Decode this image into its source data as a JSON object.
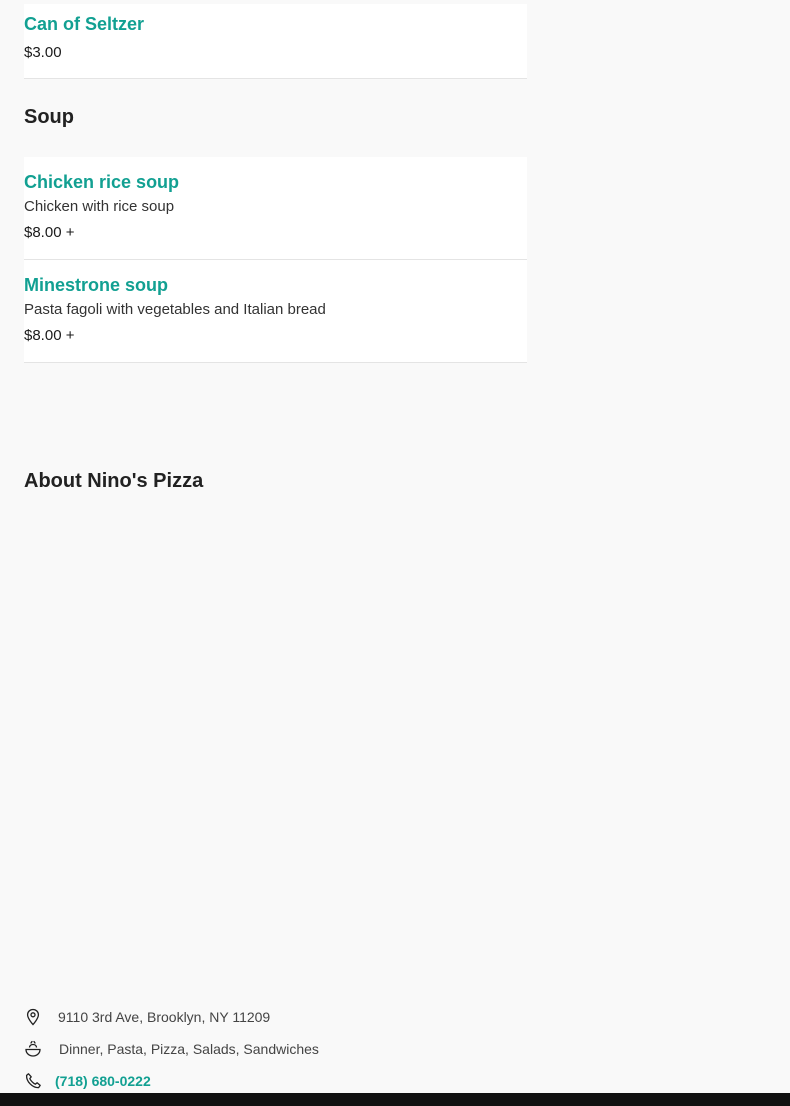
{
  "beverages": {
    "items": [
      {
        "name": "Can of Seltzer",
        "price": "$3.00"
      }
    ]
  },
  "soup": {
    "heading": "Soup",
    "items": [
      {
        "name": "Chicken rice soup",
        "description": "Chicken with rice soup",
        "price": "$8.00 +"
      },
      {
        "name": "Minestrone soup",
        "description": "Pasta fagoli with vegetables and Italian bread",
        "price": "$8.00 +"
      }
    ]
  },
  "about": {
    "heading": "About Nino's Pizza",
    "address": "9110 3rd Ave, Brooklyn, NY 11209",
    "cuisines": "Dinner, Pasta, Pizza, Salads, Sandwiches",
    "phone": "(718) 680-0222",
    "icons": {
      "address": "location-pin-icon",
      "cuisines": "food-bowl-icon",
      "phone": "phone-icon"
    }
  },
  "colors": {
    "accent": "#12a092",
    "page_background": "#f9f9f9",
    "card_background": "#ffffff",
    "text": "#1b1b1b",
    "divider": "#e4e4e4",
    "bottom_bar": "#111111"
  }
}
